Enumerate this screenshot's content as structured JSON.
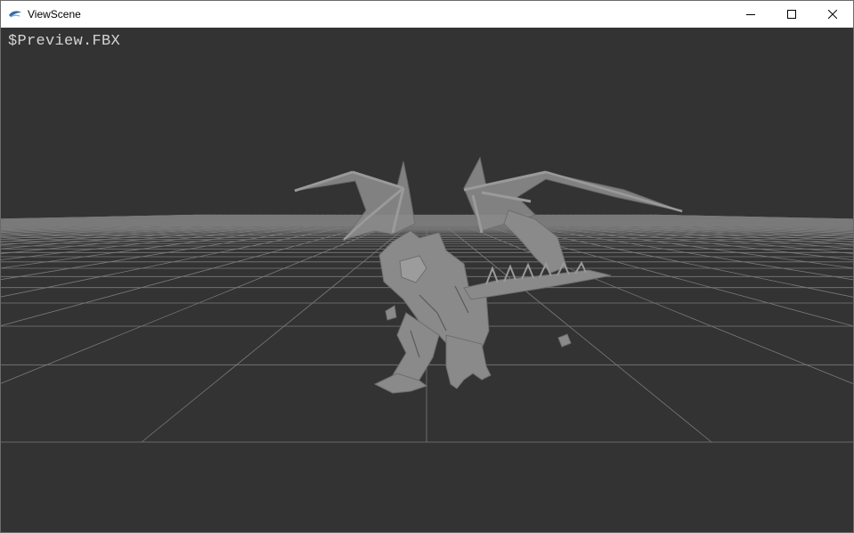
{
  "window": {
    "title": "ViewScene",
    "app_icon": "viewscene-app-icon",
    "controls": [
      "minimize-icon",
      "maximize-icon",
      "close-icon"
    ]
  },
  "viewport": {
    "overlay_label": "$Preview.FBX",
    "background_color": "#333333",
    "grid_color": "#7a7a7a",
    "model_color": "#8a8a8a",
    "model": "winged-dragon-mesh"
  }
}
